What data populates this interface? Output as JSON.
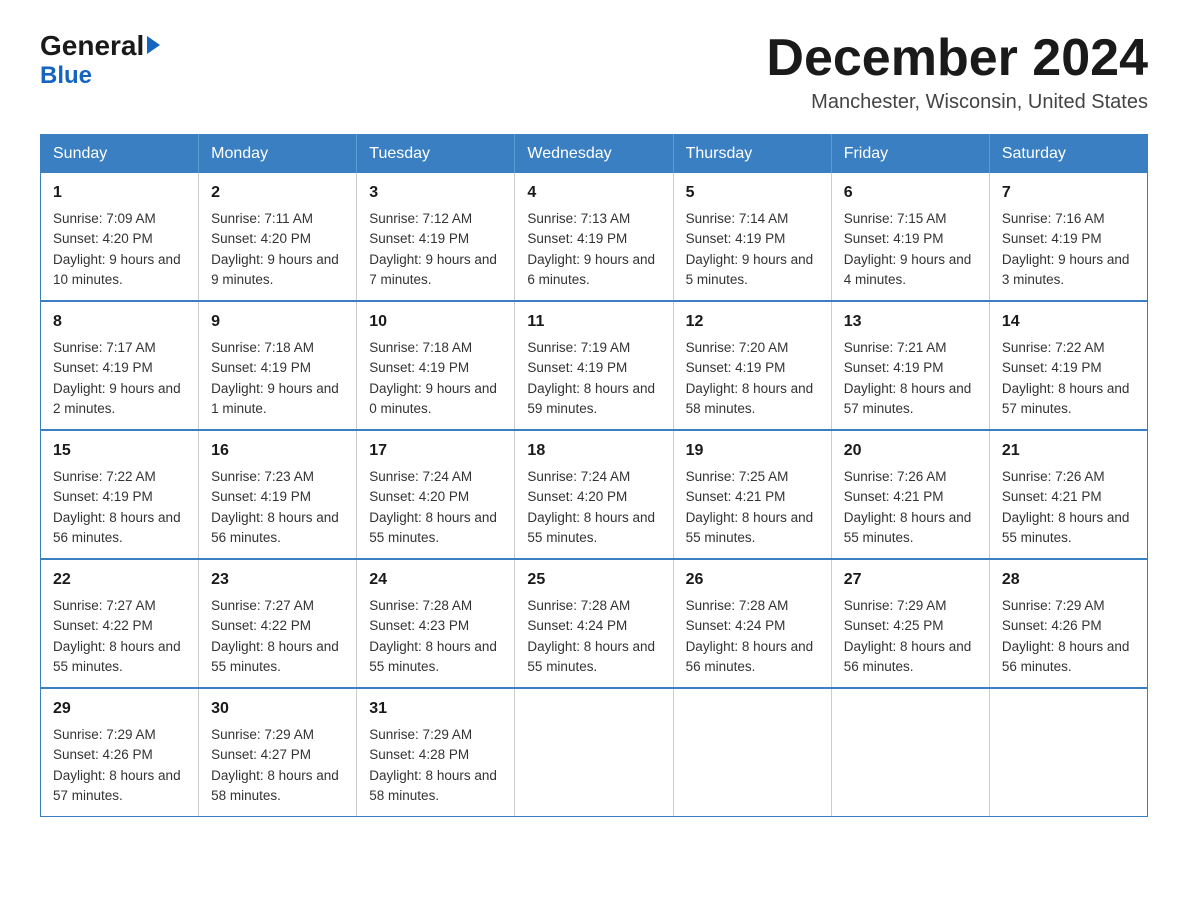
{
  "header": {
    "logo_general": "General",
    "logo_blue": "Blue",
    "month_title": "December 2024",
    "location": "Manchester, Wisconsin, United States"
  },
  "weekdays": [
    "Sunday",
    "Monday",
    "Tuesday",
    "Wednesday",
    "Thursday",
    "Friday",
    "Saturday"
  ],
  "weeks": [
    [
      {
        "day": "1",
        "sunrise": "Sunrise: 7:09 AM",
        "sunset": "Sunset: 4:20 PM",
        "daylight": "Daylight: 9 hours and 10 minutes."
      },
      {
        "day": "2",
        "sunrise": "Sunrise: 7:11 AM",
        "sunset": "Sunset: 4:20 PM",
        "daylight": "Daylight: 9 hours and 9 minutes."
      },
      {
        "day": "3",
        "sunrise": "Sunrise: 7:12 AM",
        "sunset": "Sunset: 4:19 PM",
        "daylight": "Daylight: 9 hours and 7 minutes."
      },
      {
        "day": "4",
        "sunrise": "Sunrise: 7:13 AM",
        "sunset": "Sunset: 4:19 PM",
        "daylight": "Daylight: 9 hours and 6 minutes."
      },
      {
        "day": "5",
        "sunrise": "Sunrise: 7:14 AM",
        "sunset": "Sunset: 4:19 PM",
        "daylight": "Daylight: 9 hours and 5 minutes."
      },
      {
        "day": "6",
        "sunrise": "Sunrise: 7:15 AM",
        "sunset": "Sunset: 4:19 PM",
        "daylight": "Daylight: 9 hours and 4 minutes."
      },
      {
        "day": "7",
        "sunrise": "Sunrise: 7:16 AM",
        "sunset": "Sunset: 4:19 PM",
        "daylight": "Daylight: 9 hours and 3 minutes."
      }
    ],
    [
      {
        "day": "8",
        "sunrise": "Sunrise: 7:17 AM",
        "sunset": "Sunset: 4:19 PM",
        "daylight": "Daylight: 9 hours and 2 minutes."
      },
      {
        "day": "9",
        "sunrise": "Sunrise: 7:18 AM",
        "sunset": "Sunset: 4:19 PM",
        "daylight": "Daylight: 9 hours and 1 minute."
      },
      {
        "day": "10",
        "sunrise": "Sunrise: 7:18 AM",
        "sunset": "Sunset: 4:19 PM",
        "daylight": "Daylight: 9 hours and 0 minutes."
      },
      {
        "day": "11",
        "sunrise": "Sunrise: 7:19 AM",
        "sunset": "Sunset: 4:19 PM",
        "daylight": "Daylight: 8 hours and 59 minutes."
      },
      {
        "day": "12",
        "sunrise": "Sunrise: 7:20 AM",
        "sunset": "Sunset: 4:19 PM",
        "daylight": "Daylight: 8 hours and 58 minutes."
      },
      {
        "day": "13",
        "sunrise": "Sunrise: 7:21 AM",
        "sunset": "Sunset: 4:19 PM",
        "daylight": "Daylight: 8 hours and 57 minutes."
      },
      {
        "day": "14",
        "sunrise": "Sunrise: 7:22 AM",
        "sunset": "Sunset: 4:19 PM",
        "daylight": "Daylight: 8 hours and 57 minutes."
      }
    ],
    [
      {
        "day": "15",
        "sunrise": "Sunrise: 7:22 AM",
        "sunset": "Sunset: 4:19 PM",
        "daylight": "Daylight: 8 hours and 56 minutes."
      },
      {
        "day": "16",
        "sunrise": "Sunrise: 7:23 AM",
        "sunset": "Sunset: 4:19 PM",
        "daylight": "Daylight: 8 hours and 56 minutes."
      },
      {
        "day": "17",
        "sunrise": "Sunrise: 7:24 AM",
        "sunset": "Sunset: 4:20 PM",
        "daylight": "Daylight: 8 hours and 55 minutes."
      },
      {
        "day": "18",
        "sunrise": "Sunrise: 7:24 AM",
        "sunset": "Sunset: 4:20 PM",
        "daylight": "Daylight: 8 hours and 55 minutes."
      },
      {
        "day": "19",
        "sunrise": "Sunrise: 7:25 AM",
        "sunset": "Sunset: 4:21 PM",
        "daylight": "Daylight: 8 hours and 55 minutes."
      },
      {
        "day": "20",
        "sunrise": "Sunrise: 7:26 AM",
        "sunset": "Sunset: 4:21 PM",
        "daylight": "Daylight: 8 hours and 55 minutes."
      },
      {
        "day": "21",
        "sunrise": "Sunrise: 7:26 AM",
        "sunset": "Sunset: 4:21 PM",
        "daylight": "Daylight: 8 hours and 55 minutes."
      }
    ],
    [
      {
        "day": "22",
        "sunrise": "Sunrise: 7:27 AM",
        "sunset": "Sunset: 4:22 PM",
        "daylight": "Daylight: 8 hours and 55 minutes."
      },
      {
        "day": "23",
        "sunrise": "Sunrise: 7:27 AM",
        "sunset": "Sunset: 4:22 PM",
        "daylight": "Daylight: 8 hours and 55 minutes."
      },
      {
        "day": "24",
        "sunrise": "Sunrise: 7:28 AM",
        "sunset": "Sunset: 4:23 PM",
        "daylight": "Daylight: 8 hours and 55 minutes."
      },
      {
        "day": "25",
        "sunrise": "Sunrise: 7:28 AM",
        "sunset": "Sunset: 4:24 PM",
        "daylight": "Daylight: 8 hours and 55 minutes."
      },
      {
        "day": "26",
        "sunrise": "Sunrise: 7:28 AM",
        "sunset": "Sunset: 4:24 PM",
        "daylight": "Daylight: 8 hours and 56 minutes."
      },
      {
        "day": "27",
        "sunrise": "Sunrise: 7:29 AM",
        "sunset": "Sunset: 4:25 PM",
        "daylight": "Daylight: 8 hours and 56 minutes."
      },
      {
        "day": "28",
        "sunrise": "Sunrise: 7:29 AM",
        "sunset": "Sunset: 4:26 PM",
        "daylight": "Daylight: 8 hours and 56 minutes."
      }
    ],
    [
      {
        "day": "29",
        "sunrise": "Sunrise: 7:29 AM",
        "sunset": "Sunset: 4:26 PM",
        "daylight": "Daylight: 8 hours and 57 minutes."
      },
      {
        "day": "30",
        "sunrise": "Sunrise: 7:29 AM",
        "sunset": "Sunset: 4:27 PM",
        "daylight": "Daylight: 8 hours and 58 minutes."
      },
      {
        "day": "31",
        "sunrise": "Sunrise: 7:29 AM",
        "sunset": "Sunset: 4:28 PM",
        "daylight": "Daylight: 8 hours and 58 minutes."
      },
      null,
      null,
      null,
      null
    ]
  ]
}
